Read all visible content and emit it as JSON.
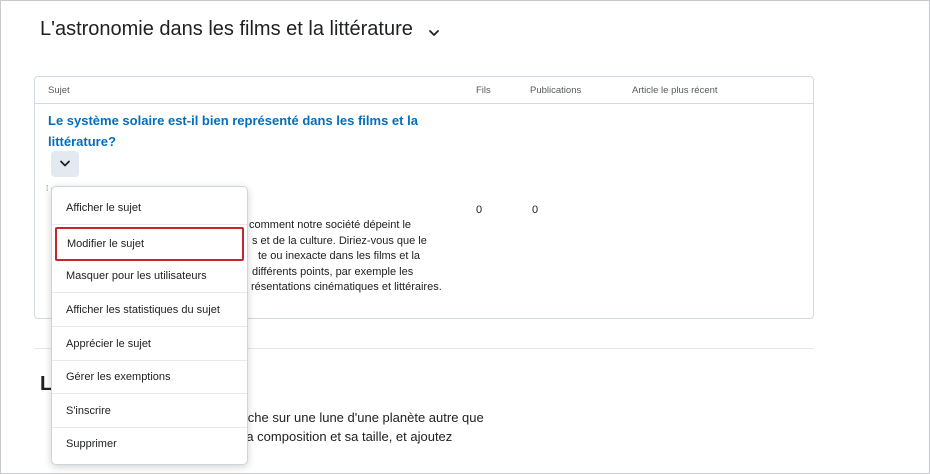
{
  "forum": {
    "title": "L'astronomie dans les films et la littérature"
  },
  "table": {
    "headers": {
      "subject": "Sujet",
      "threads": "Fils",
      "posts": "Publications",
      "latest": "Article le plus récent"
    }
  },
  "topic": {
    "title_line1": "Le système solaire est-il bien représenté dans les films et la",
    "title_line2": "littérature?",
    "threads": "0",
    "posts": "0",
    "description_lines": [
      "comment notre société dépeint le",
      "s et de la culture. Diriez-vous que le",
      "te ou inexacte dans les films et la",
      "différents points, par exemple les",
      "résentations cinématiques et littéraires."
    ]
  },
  "context_menu": {
    "items": [
      "Afficher le sujet",
      "Modifier le sujet",
      "Masquer pour les utilisateurs",
      "Afficher les statistiques du sujet",
      "Apprécier le sujet",
      "Gérer les exemptions",
      "S'inscrire",
      "Supprimer"
    ],
    "highlighted_index": 1,
    "highlight_color": "#c0282e"
  },
  "second_topic": {
    "title": "L",
    "description_lines": [
      "herche sur une lune d'une planète autre que",
      "t, sa composition et sa taille, et ajoutez",
      ""
    ]
  },
  "colors": {
    "link": "#006fbf",
    "border": "#d3d9e3",
    "button_bg": "#e3e9f1"
  },
  "icons": {
    "forum_toggle": "chevron-down-icon",
    "context_menu_toggle": "chevron-down-icon"
  }
}
